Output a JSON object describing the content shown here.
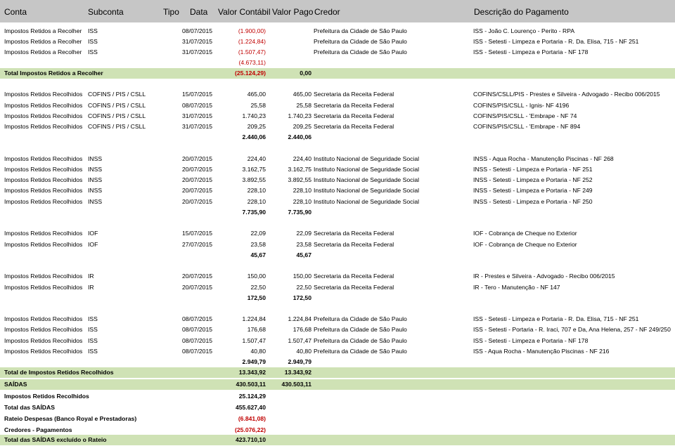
{
  "header": {
    "conta": "Conta",
    "subconta": "Subconta",
    "tipo": "Tipo",
    "data": "Data",
    "valor_contabil": "Valor Contábil",
    "valor_pago": "Valor Pago",
    "credor": "Credor",
    "descricao": "Descrição do Pagamento"
  },
  "rows": [
    {
      "conta": "Impostos Retidos a Recolher",
      "subconta": "ISS",
      "data": "08/07/2015",
      "contabil": "(1.900,00)",
      "pago": "",
      "credor": "Prefeitura da Cidade de São Paulo",
      "desc": "ISS - João C. Lourenço - Perito - RPA"
    },
    {
      "conta": "Impostos Retidos a Recolher",
      "subconta": "ISS",
      "data": "31/07/2015",
      "contabil": "(1.224,84)",
      "pago": "",
      "credor": "Prefeitura da Cidade de São Paulo",
      "desc": "ISS - Setesti - Limpeza e Portaria - R. Da. Elisa, 715 - NF 251"
    },
    {
      "conta": "Impostos Retidos a Recolher",
      "subconta": "ISS",
      "data": "31/07/2015",
      "contabil": "(1.507,47)",
      "pago": "",
      "credor": "Prefeitura da Cidade de São Paulo",
      "desc": "ISS - Setesti - Limpeza e Portaria - NF 178"
    },
    {
      "conta": "",
      "subconta": "",
      "data": "",
      "contabil": "(4.673,11)",
      "pago": "",
      "credor": "",
      "desc": ""
    },
    {
      "conta": "Total Impostos Retidos a Recolher",
      "subconta": "",
      "data": "",
      "contabil": "(25.124,29)",
      "pago": "0,00",
      "credor": "",
      "desc": ""
    },
    {
      "conta": "Impostos Retidos Recolhidos",
      "subconta": "COFINS / PIS / CSLL",
      "data": "15/07/2015",
      "contabil": "465,00",
      "pago": "465,00",
      "credor": "Secretaria da Receita Federal",
      "desc": "COFINS/CSLL/PIS -  Prestes e Silveira - Advogado - Recibo 006/2015"
    },
    {
      "conta": "Impostos Retidos Recolhidos",
      "subconta": "COFINS / PIS / CSLL",
      "data": "08/07/2015",
      "contabil": "25,58",
      "pago": "25,58",
      "credor": "Secretaria da Receita Federal",
      "desc": "COFINS/PIS/CSLL - Ignis- NF 4196"
    },
    {
      "conta": "Impostos Retidos Recolhidos",
      "subconta": "COFINS / PIS / CSLL",
      "data": "31/07/2015",
      "contabil": "1.740,23",
      "pago": "1.740,23",
      "credor": "Secretaria da Receita Federal",
      "desc": "COFINS/PIS/CSLL - 'Embrape  - NF 74"
    },
    {
      "conta": "Impostos Retidos Recolhidos",
      "subconta": "COFINS / PIS / CSLL",
      "data": "31/07/2015",
      "contabil": "209,25",
      "pago": "209,25",
      "credor": "Secretaria da Receita Federal",
      "desc": "COFINS/PIS/CSLL - 'Embrape  - NF 894"
    },
    {
      "conta": "",
      "subconta": "",
      "data": "",
      "contabil": "2.440,06",
      "pago": "2.440,06",
      "credor": "",
      "desc": ""
    },
    {
      "conta": "Impostos Retidos Recolhidos",
      "subconta": "INSS",
      "data": "20/07/2015",
      "contabil": "224,40",
      "pago": "224,40",
      "credor": "Instituto Nacional de Seguridade Social",
      "desc": "INSS - Aqua Rocha - Manutenção Piscinas - NF 268"
    },
    {
      "conta": "Impostos Retidos Recolhidos",
      "subconta": "INSS",
      "data": "20/07/2015",
      "contabil": "3.162,75",
      "pago": "3.162,75",
      "credor": "Instituto Nacional de Seguridade Social",
      "desc": "INSS - Setesti - Limpeza e Portaria - NF 251"
    },
    {
      "conta": "Impostos Retidos Recolhidos",
      "subconta": "INSS",
      "data": "20/07/2015",
      "contabil": "3.892,55",
      "pago": "3.892,55",
      "credor": "Instituto Nacional de Seguridade Social",
      "desc": "INSS - Setesti - Limpeza e Portaria - NF 252"
    },
    {
      "conta": "Impostos Retidos Recolhidos",
      "subconta": "INSS",
      "data": "20/07/2015",
      "contabil": "228,10",
      "pago": "228,10",
      "credor": "Instituto Nacional de Seguridade Social",
      "desc": "INSS - Setesti - Limpeza e Portaria - NF 249"
    },
    {
      "conta": "Impostos Retidos Recolhidos",
      "subconta": "INSS",
      "data": "20/07/2015",
      "contabil": "228,10",
      "pago": "228,10",
      "credor": "Instituto Nacional de Seguridade Social",
      "desc": "INSS - Setesti - Limpeza e Portaria - NF 250"
    },
    {
      "conta": "",
      "subconta": "",
      "data": "",
      "contabil": "7.735,90",
      "pago": "7.735,90",
      "credor": "",
      "desc": ""
    },
    {
      "conta": "Impostos Retidos Recolhidos",
      "subconta": "IOF",
      "data": "15/07/2015",
      "contabil": "22,09",
      "pago": "22,09",
      "credor": "Secretaria da Receita Federal",
      "desc": "IOF - Cobrança de Cheque no Exterior"
    },
    {
      "conta": "Impostos Retidos Recolhidos",
      "subconta": "IOF",
      "data": "27/07/2015",
      "contabil": "23,58",
      "pago": "23,58",
      "credor": "Secretaria da Receita Federal",
      "desc": "IOF - Cobrança de Cheque no Exterior"
    },
    {
      "conta": "",
      "subconta": "",
      "data": "",
      "contabil": "45,67",
      "pago": "45,67",
      "credor": "",
      "desc": ""
    },
    {
      "conta": "Impostos Retidos Recolhidos",
      "subconta": "IR",
      "data": "20/07/2015",
      "contabil": "150,00",
      "pago": "150,00",
      "credor": "Secretaria da Receita Federal",
      "desc": "IR - Prestes e Silveira - Advogado - Recibo 006/2015"
    },
    {
      "conta": "Impostos Retidos Recolhidos",
      "subconta": "IR",
      "data": "20/07/2015",
      "contabil": "22,50",
      "pago": "22,50",
      "credor": "Secretaria da Receita Federal",
      "desc": "IR - Tero - Manutenção - NF 147"
    },
    {
      "conta": "",
      "subconta": "",
      "data": "",
      "contabil": "172,50",
      "pago": "172,50",
      "credor": "",
      "desc": ""
    },
    {
      "conta": "Impostos Retidos Recolhidos",
      "subconta": "ISS",
      "data": "08/07/2015",
      "contabil": "1.224,84",
      "pago": "1.224,84",
      "credor": "Prefeitura da Cidade de São Paulo",
      "desc": "ISS - Setesti - Limpeza e Portaria - R. Da. Elisa, 715 - NF 251"
    },
    {
      "conta": "Impostos Retidos Recolhidos",
      "subconta": "ISS",
      "data": "08/07/2015",
      "contabil": "176,68",
      "pago": "176,68",
      "credor": "Prefeitura da Cidade de São Paulo",
      "desc": "ISS - Setesti - Portaria - R. Iraci, 707 e Da, Ana Helena, 257 - NF 249/250"
    },
    {
      "conta": "Impostos Retidos Recolhidos",
      "subconta": "ISS",
      "data": "08/07/2015",
      "contabil": "1.507,47",
      "pago": "1.507,47",
      "credor": "Prefeitura da Cidade de São Paulo",
      "desc": "ISS - Setesti - Limpeza e Portaria - NF 178"
    },
    {
      "conta": "Impostos Retidos Recolhidos",
      "subconta": "ISS",
      "data": "08/07/2015",
      "contabil": "40,80",
      "pago": "40,80",
      "credor": "Prefeitura da Cidade de São Paulo",
      "desc": "ISS - Aqua Rocha - Manutenção Piscinas - NF 216"
    },
    {
      "conta": "",
      "subconta": "",
      "data": "",
      "contabil": "2.949,79",
      "pago": "2.949,79",
      "credor": "",
      "desc": ""
    },
    {
      "conta": "Total de Impostos Retidos Recolhidos",
      "subconta": "",
      "data": "",
      "contabil": "13.343,92",
      "pago": "13.343,92",
      "credor": "",
      "desc": ""
    },
    {
      "conta": "SAÍDAS",
      "subconta": "",
      "data": "",
      "contabil": "430.503,11",
      "pago": "430.503,11",
      "credor": "",
      "desc": ""
    },
    {
      "conta": "Impostos Retidos Recolhidos",
      "subconta": "",
      "data": "",
      "contabil": "25.124,29",
      "pago": "",
      "credor": "",
      "desc": ""
    },
    {
      "conta": "Total das SAÍDAS",
      "subconta": "",
      "data": "",
      "contabil": "455.627,40",
      "pago": "",
      "credor": "",
      "desc": ""
    },
    {
      "conta": "Rateio Despesas (Banco Royal e Prestadoras)",
      "subconta": "",
      "data": "",
      "contabil": "(6.841,08)",
      "pago": "",
      "credor": "",
      "desc": ""
    },
    {
      "conta": "Credores - Pagamentos",
      "subconta": "",
      "data": "",
      "contabil": "(25.076,22)",
      "pago": "",
      "credor": "",
      "desc": ""
    },
    {
      "conta": "Total das SAÍDAS excluído o Rateio",
      "subconta": "",
      "data": "",
      "contabil": "423.710,10",
      "pago": "",
      "credor": "",
      "desc": ""
    }
  ]
}
